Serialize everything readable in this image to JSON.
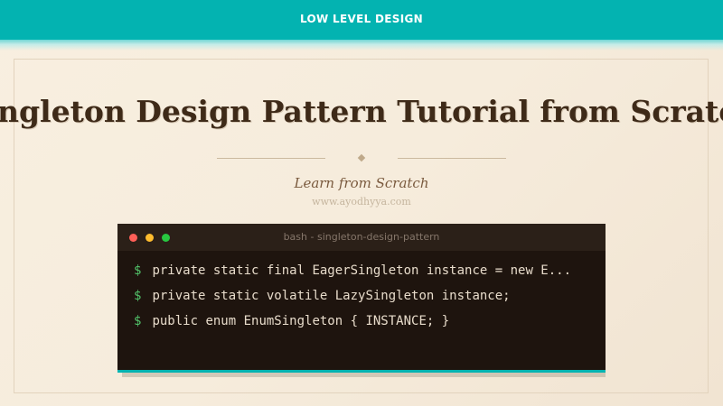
{
  "header": {
    "label": "LOW LEVEL DESIGN"
  },
  "hero": {
    "title": "Singleton Design Pattern Tutorial from Scratch",
    "subtitle": "Learn from Scratch",
    "site": "www.ayodhyya.com"
  },
  "terminal": {
    "title": "bash - singleton-design-pattern",
    "prompt": "$",
    "lines": [
      "private static final EagerSingleton instance = new E...",
      "private static volatile LazySingleton instance;",
      "public enum EnumSingleton { INSTANCE; }"
    ]
  },
  "colors": {
    "accent": "#03b3b1",
    "background": "#f6ecdc",
    "title": "#3e2a18",
    "terminal_bg": "#1e140e",
    "prompt": "#52c46a"
  }
}
